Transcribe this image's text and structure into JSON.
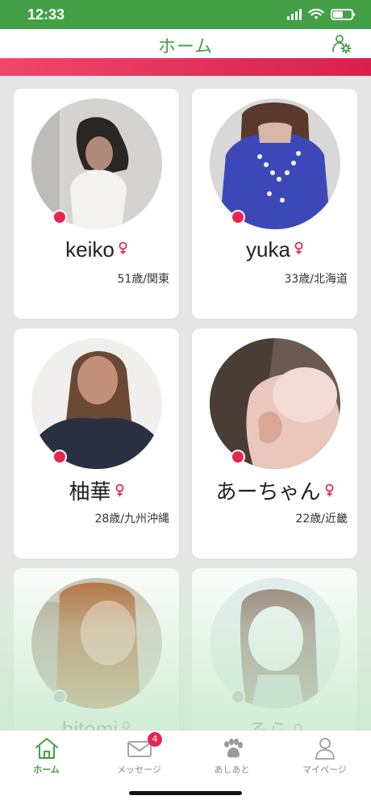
{
  "status_bar": {
    "time": "12:33"
  },
  "nav": {
    "title": "ホーム"
  },
  "colors": {
    "accent": "#43a047",
    "pink": "#e8254f",
    "online": "#e8254f",
    "offline": "#9e9e9e"
  },
  "profiles": [
    {
      "name": "keiko",
      "info": "51歳/関東",
      "online": true
    },
    {
      "name": "yuka",
      "info": "33歳/北海道",
      "online": true
    },
    {
      "name": "柚華",
      "info": "28歳/九州沖縄",
      "online": true
    },
    {
      "name": "あーちゃん",
      "info": "22歳/近畿",
      "online": true
    },
    {
      "name": "hitomi",
      "info": "",
      "online": false
    },
    {
      "name": "そら",
      "info": "",
      "online": false
    }
  ],
  "tabs": [
    {
      "label": "ホーム",
      "icon": "home-icon",
      "active": true
    },
    {
      "label": "メッセージ",
      "icon": "mail-icon",
      "badge": "4"
    },
    {
      "label": "あしあと",
      "icon": "paw-icon"
    },
    {
      "label": "マイページ",
      "icon": "person-icon"
    }
  ]
}
